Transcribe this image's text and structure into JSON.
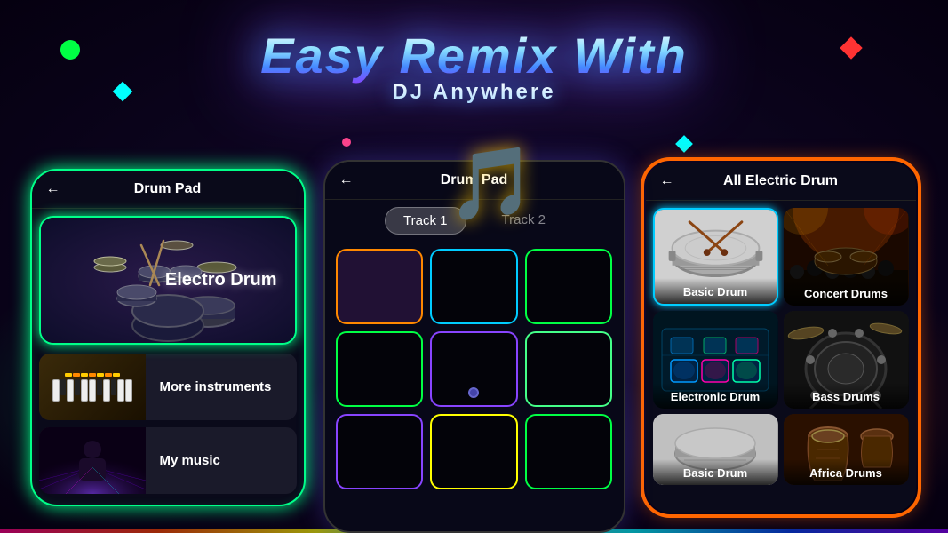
{
  "header": {
    "title_main": "Easy Remix With",
    "title_sub": "DJ Anywhere"
  },
  "left_phone": {
    "title": "Drum Pad",
    "back_icon": "←",
    "items": [
      {
        "id": "electro-drum",
        "label": "Electro Drum",
        "type": "featured"
      },
      {
        "id": "more-instruments",
        "label": "More instruments",
        "type": "list"
      },
      {
        "id": "my-music",
        "label": "My music",
        "type": "list"
      }
    ]
  },
  "center_phone": {
    "title": "Drum Pad",
    "back_icon": "←",
    "tabs": [
      {
        "id": "track1",
        "label": "Track 1",
        "active": true
      },
      {
        "id": "track2",
        "label": "Track 2",
        "active": false
      }
    ],
    "pads": [
      {
        "id": "pad1",
        "color": "orange"
      },
      {
        "id": "pad2",
        "color": "cyan"
      },
      {
        "id": "pad3",
        "color": "green"
      },
      {
        "id": "pad4",
        "color": "green"
      },
      {
        "id": "pad5",
        "color": "purple",
        "has_circle": true
      },
      {
        "id": "pad6",
        "color": "green"
      },
      {
        "id": "pad7",
        "color": "purple"
      },
      {
        "id": "pad8",
        "color": "yellow"
      },
      {
        "id": "pad9",
        "color": "green"
      }
    ]
  },
  "right_phone": {
    "title": "All Electric Drum",
    "back_icon": "←",
    "drums": [
      {
        "id": "basic-drum",
        "label": "Basic Drum",
        "selected": true
      },
      {
        "id": "concert-drums",
        "label": "Concert Drums",
        "selected": false
      },
      {
        "id": "electronic-drum",
        "label": "Electronic Drum",
        "selected": false
      },
      {
        "id": "bass-drums",
        "label": "Bass Drums",
        "selected": false
      },
      {
        "id": "basic-drum-2",
        "label": "Basic Drum",
        "selected": false
      },
      {
        "id": "africa-drums",
        "label": "Africa Drums",
        "selected": false
      }
    ]
  },
  "decorations": {
    "music_note": "🎵"
  }
}
